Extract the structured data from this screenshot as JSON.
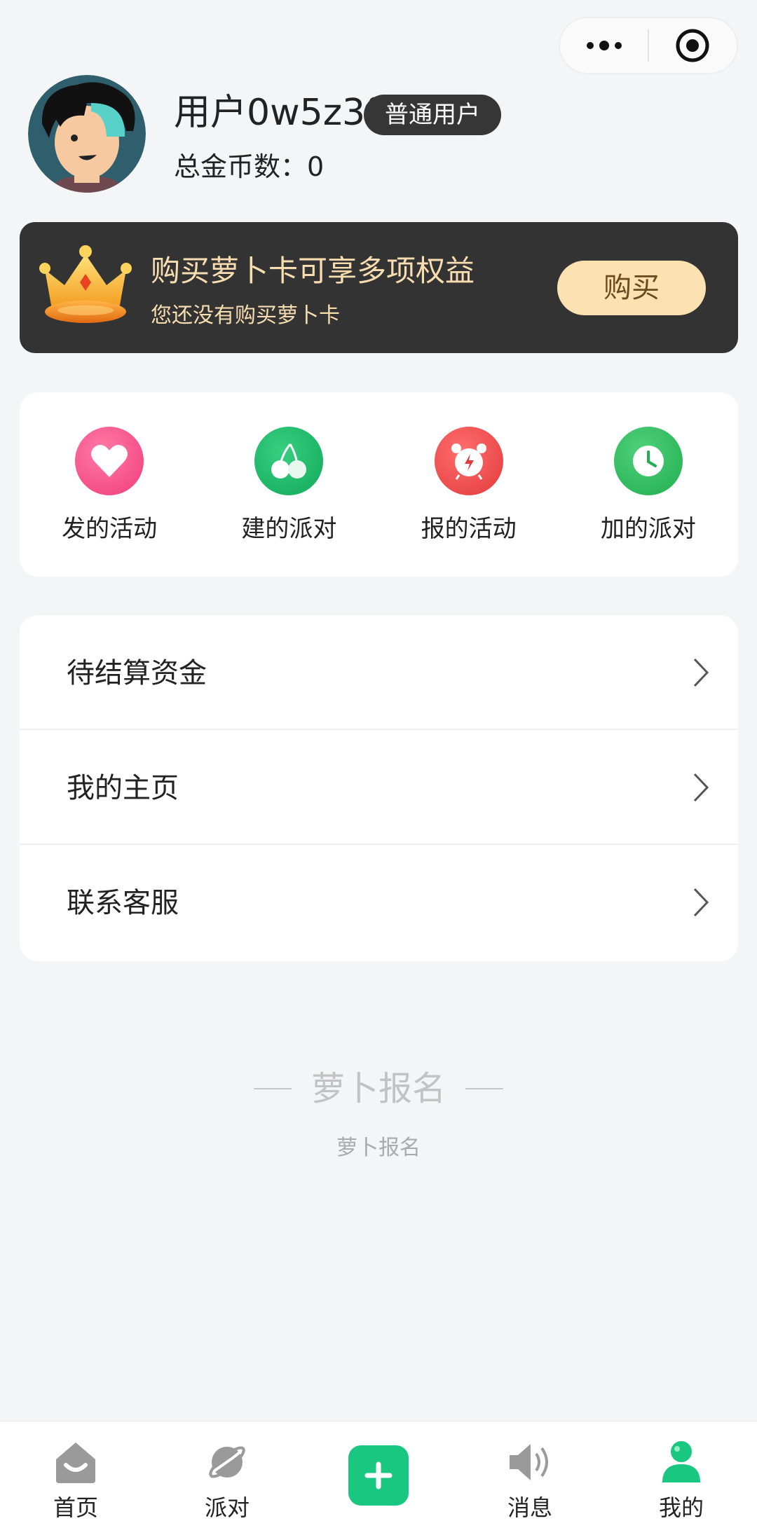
{
  "header": {
    "capsule": {
      "more_icon": "more-dots-icon",
      "close_icon": "target-icon"
    }
  },
  "profile": {
    "username": "用户0w5z3f",
    "badge": "普通用户",
    "coins_label": "总金币数：",
    "coins_value": "0"
  },
  "vip_banner": {
    "title": "购买萝卜卡可享多项权益",
    "subtitle": "您还没有购买萝卜卡",
    "button": "购买",
    "colors": {
      "background": "#333333",
      "text": "#f7ddb0",
      "button": "#fbe2b0"
    }
  },
  "quick_actions": [
    {
      "label": "发的活动",
      "icon": "heart-icon",
      "color": "#f4528b"
    },
    {
      "label": "建的派对",
      "icon": "cherry-icon",
      "color": "#19b96b"
    },
    {
      "label": "报的活动",
      "icon": "alarm-clock-icon",
      "color": "#ec4a4a"
    },
    {
      "label": "加的派对",
      "icon": "clock-icon",
      "color": "#2fbf5d"
    }
  ],
  "menu": [
    {
      "label": "待结算资金"
    },
    {
      "label": "我的主页"
    },
    {
      "label": "联系客服"
    }
  ],
  "footer": {
    "brand": "萝卜报名",
    "sub": "萝卜报名"
  },
  "tabbar": [
    {
      "label": "首页",
      "icon": "home-icon",
      "active": false
    },
    {
      "label": "派对",
      "icon": "planet-icon",
      "active": false
    },
    {
      "label": "",
      "icon": "plus-icon",
      "active": false
    },
    {
      "label": "消息",
      "icon": "speaker-icon",
      "active": false
    },
    {
      "label": "我的",
      "icon": "user-icon",
      "active": true
    }
  ],
  "colors": {
    "accent": "#19c781",
    "inactive_icon": "#9a9a9a"
  }
}
